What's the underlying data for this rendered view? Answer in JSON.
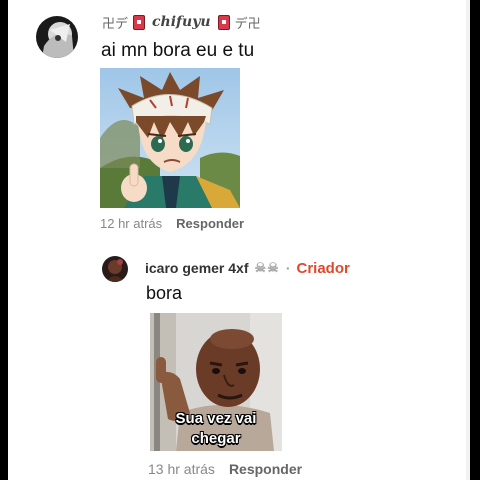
{
  "comment1": {
    "username": "chifuyu",
    "deco_left": "卍デ",
    "deco_right": "デ卍",
    "text": "ai mn bora eu e tu",
    "timestamp": "12 hr atrás",
    "reply_label": "Responder"
  },
  "reply1": {
    "username": "icaro gemer 4xf",
    "skulls": "☠☠",
    "separator": "·",
    "badge": "Criador",
    "text": "bora",
    "meme_caption_line1": "Sua vez vai",
    "meme_caption_line2": "chegar",
    "timestamp": "13 hr atrás",
    "reply_label": "Responder"
  },
  "colors": {
    "badge": "#e0492a",
    "card": "#d9394a"
  }
}
